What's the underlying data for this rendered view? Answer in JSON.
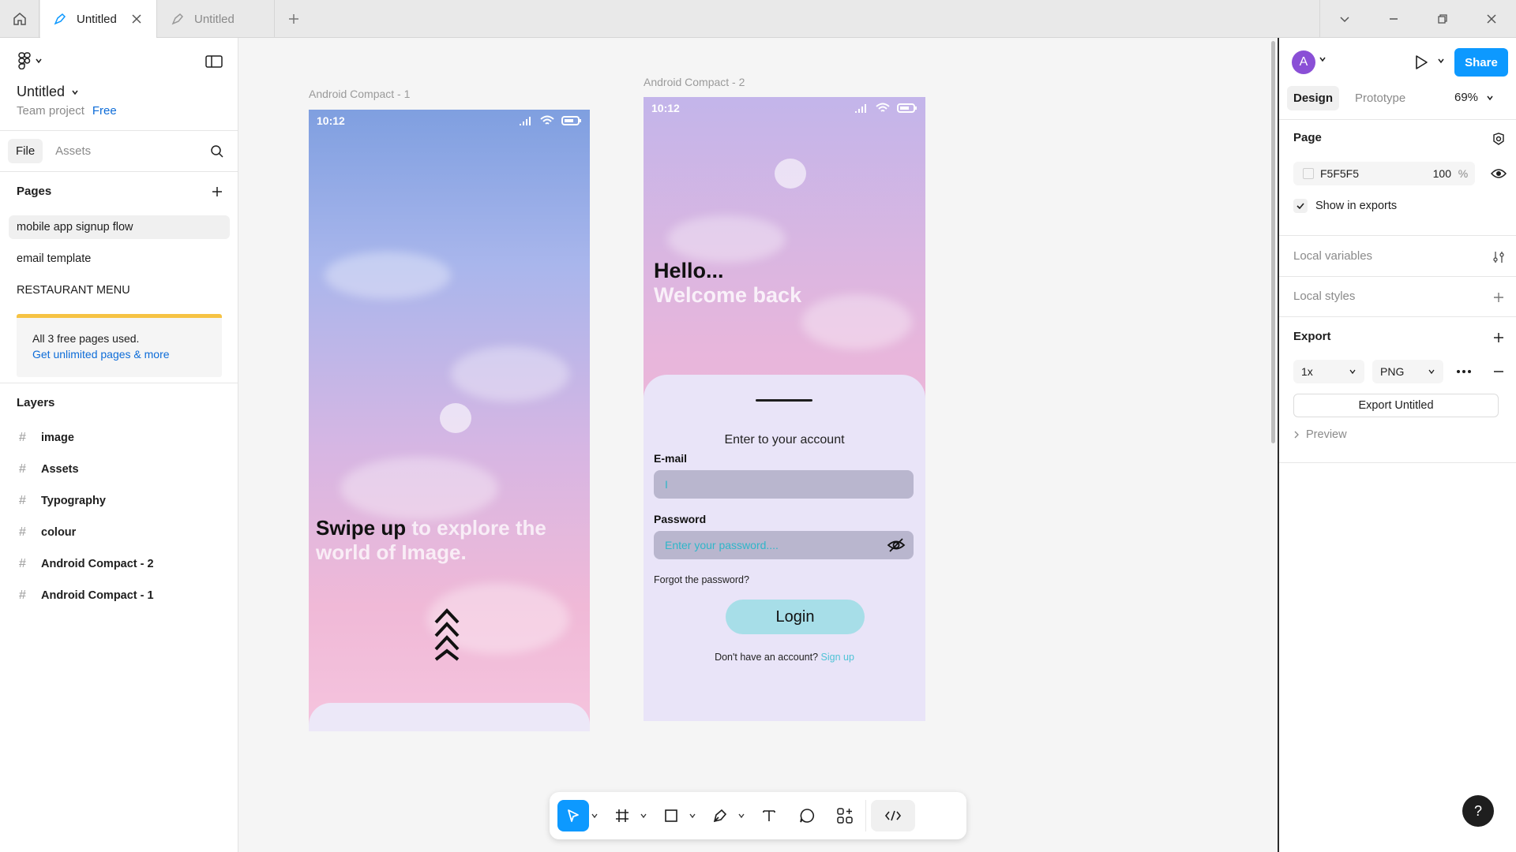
{
  "tabs": [
    {
      "label": "Untitled",
      "active": true
    },
    {
      "label": "Untitled",
      "active": false
    }
  ],
  "sidebar": {
    "file_title": "Untitled",
    "team": "Team project",
    "plan": "Free",
    "tabs": [
      "File",
      "Assets"
    ],
    "pages_heading": "Pages",
    "pages": [
      "mobile app signup flow",
      "email template",
      "RESTAURANT MENU"
    ],
    "upgrade_text": "All 3 free pages used.",
    "upgrade_link": "Get unlimited pages & more",
    "layers_heading": "Layers",
    "layers": [
      "image",
      "Assets",
      "Typography",
      "colour",
      "Android Compact - 2",
      "Android Compact - 1"
    ]
  },
  "canvas": {
    "frame1": {
      "label": "Android Compact - 1",
      "time": "10:12",
      "swipe_dark": "Swipe up",
      "swipe_light": " to explore the world of Image."
    },
    "frame2": {
      "label": "Android Compact - 2",
      "time": "10:12",
      "hello": "Hello...",
      "welcome": "Welcome back",
      "enter": "Enter to your account",
      "email_label": "E-mail",
      "email_value": "I",
      "password_label": "Password",
      "password_placeholder": "Enter your password....",
      "forgot": "Forgot the password?",
      "login": "Login",
      "no_account": "Don't have an account?",
      "sign_up": "Sign up"
    }
  },
  "toolbar_icons": [
    "move-tool",
    "frame-tool",
    "shape-tool",
    "pen-tool",
    "text-tool",
    "comment-tool",
    "actions-tool",
    "dev-mode-toggle"
  ],
  "right_panel": {
    "avatar": "A",
    "share": "Share",
    "tabs": [
      "Design",
      "Prototype"
    ],
    "zoom": "69%",
    "page_heading": "Page",
    "page_color": "F5F5F5",
    "page_opacity": "100",
    "page_opacity_unit": "%",
    "show_in_exports": "Show in exports",
    "local_variables": "Local variables",
    "local_styles": "Local styles",
    "export_heading": "Export",
    "export_scale": "1x",
    "export_format": "PNG",
    "export_button": "Export Untitled",
    "preview": "Preview"
  },
  "help": "?",
  "colors": {
    "accent": "#0d99ff",
    "brand_yellow": "#f6c343",
    "link": "#0d6cd8",
    "avatar": "#8a4fd6"
  }
}
